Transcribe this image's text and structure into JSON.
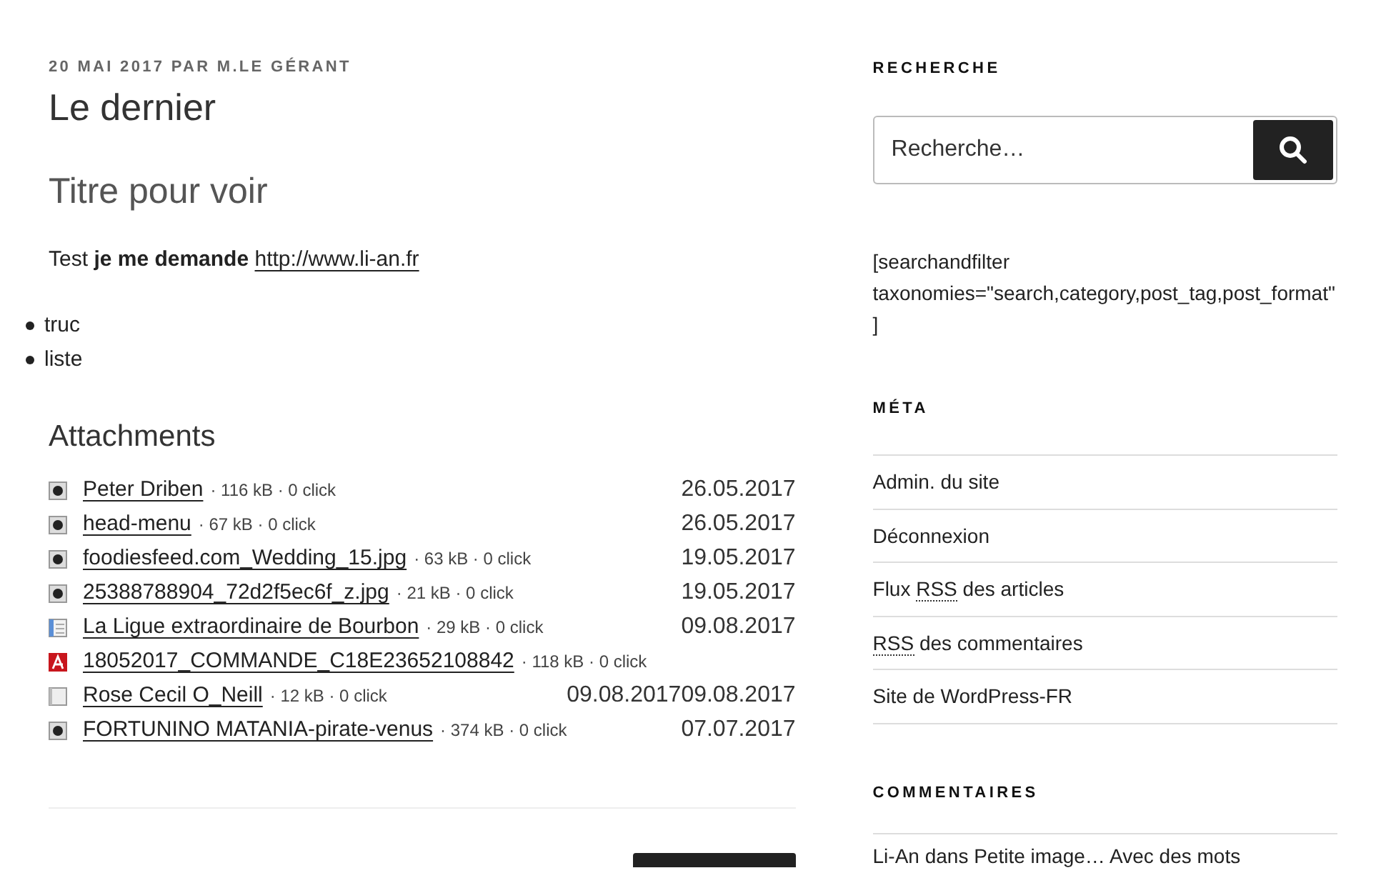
{
  "post": {
    "meta": "20 MAI 2017 PAR M.LE GÉRANT",
    "title": "Le dernier",
    "subtitle": "Titre pour voir",
    "paragraph": {
      "text": "Test **je me demande**",
      "link": "http://www.li-an.fr"
    },
    "list": [
      "truc",
      "liste"
    ],
    "attachments_title": "Attachments",
    "attachments": [
      {
        "kind": "image",
        "name": "Peter Driben",
        "info": "· 116 kB · 0 click",
        "date": "26.05.2017"
      },
      {
        "kind": "image",
        "name": "head-menu",
        "info": "· 67 kB · 0 click",
        "date": "26.05.2017"
      },
      {
        "kind": "image",
        "name": "foodiesfeed.com_Wedding_15.jpg",
        "info": "· 63 kB · 0 click",
        "date": "19.05.2017"
      },
      {
        "kind": "image",
        "name": "25388788904_72d2f5ec6f_z.jpg",
        "info": "· 21 kB · 0 click",
        "date": "19.05.2017"
      },
      {
        "kind": "document",
        "name": "La Ligue extraordinaire de Bourbon",
        "info": "· 29 kB · 0 click",
        "date": "09.08.2017"
      },
      {
        "kind": "pdf",
        "name": "18052017_COMMANDE_C18E23652108842",
        "info": "· 118 kB · 0 click"
      },
      {
        "kind": "generic",
        "name": "Rose Cecil O_Neill",
        "info": "· 12 kB · 0 click",
        "date": "09.08.201709.08.2017"
      },
      {
        "kind": "image",
        "name": "FORTUNINO MATANIA-pirate-venus",
        "info": "· 374 kB · 0 click",
        "date": "07.07.2017"
      }
    ]
  },
  "sidebar": {
    "search": {
      "heading": "RECHERCHE",
      "placeholder": "Recherche…"
    },
    "shortcode": "[searchandfilter taxonomies=\"search,category,post_tag,post_format\"]",
    "meta": {
      "heading": "MÉTA",
      "items": [
        {
          "before": "Admin. du site"
        },
        {
          "before": "Déconnexion"
        },
        {
          "before": "Flux ",
          "abbr": "RSS",
          "after": " des articles"
        },
        {
          "abbr": "RSS",
          "after": " des commentaires"
        },
        {
          "before": "Site de WordPress-FR"
        }
      ]
    },
    "comments": {
      "heading": "COMMENTAIRES",
      "items": [
        "Li-An dans Petite image… Avec des mots"
      ]
    }
  }
}
